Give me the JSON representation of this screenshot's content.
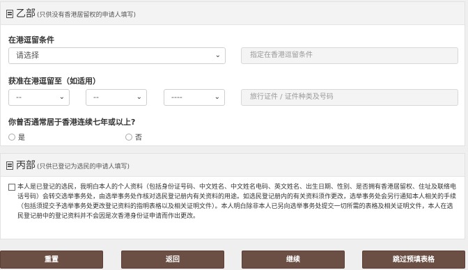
{
  "section_b": {
    "title": "乙部",
    "note": "(只供没有香港居留权的申请人填写)",
    "condition_label": "在港逗留条件",
    "condition_select": "请选择",
    "condition_text_placeholder": "指定在香港逗留条件",
    "stay_until_label": "获准在港逗留至（如适用）",
    "day_select": "--",
    "month_select": "--",
    "year_select": "----",
    "travel_doc_placeholder": "旅行证件 / 证件种类及号码",
    "residence_question": "你曾否通常居于香港连续七年或以上?",
    "radio_yes": "是",
    "radio_no": "否"
  },
  "section_c": {
    "title": "丙部",
    "note": "(只供已登记为选民的申请人填写)",
    "declaration": "本人是已登记的选民，我明白本人的个人资料（包括身份证号码、中文姓名、中文姓名电码、英文姓名、出生日期、性别、是否拥有香港居留权、住址及联络电话号码）会转交选举事务处，由选举事务处作核对选民登记册内有关资料的用途。如选民登记册内的有关资料须作更改，选举事务处会另行通知本人相关的手续（包括须提交予选举事务处更改登记资料的指明表格以及相关证明文件）。本人明白除非本人已另向选举事务处提交一切所需的表格及相关证明文件，本人在选民登记册中的登记资料并不会因是次香港身份证申请而作出更改。"
  },
  "buttons": {
    "reset": "重置",
    "back": "返回",
    "continue": "继续",
    "skip": "跳过预填表格"
  },
  "colors": {
    "button_bg": "#6b4e44",
    "header_bg": "#f3f3f3",
    "page_bg": "#efefef"
  }
}
